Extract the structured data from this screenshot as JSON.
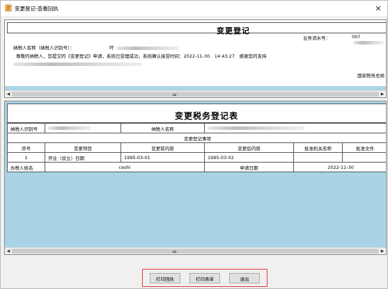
{
  "window": {
    "title": "变更登记-查看回执",
    "close_glyph": "✕"
  },
  "receipt": {
    "title": "变更登记",
    "serial_label": "业务流水号：",
    "serial_value": "007",
    "taxpayer_label": "纳税人名称（纳税人识别号）：",
    "taxpayer_value": "叶",
    "notice": "尊敬的纳税人，您提交的《变更登记》申请，系统已受理成功，系统确认接受时间：2022-11-30　14:43:27　感谢您的支持",
    "bureau": "国家税务总局"
  },
  "form": {
    "title": "变更税务登记表",
    "taxpayer_id_label": "纳税人识别号",
    "taxpayer_id_value": "91...",
    "taxpayer_name_label": "纳税人名称",
    "taxpayer_name_value": "叶...",
    "section_label": "变更登记事项",
    "columns": [
      "序号",
      "变更项目",
      "变更前内容",
      "变更后内容",
      "批准机关名称",
      "批准文件"
    ],
    "rows": [
      {
        "seq": "1",
        "item": "开业（设立）日期",
        "before": "1995-03-01",
        "after": "1995-03-02",
        "authority": "",
        "document": ""
      }
    ],
    "handler_label": "办税人姓名",
    "handler_value": "ceshi",
    "apply_date_label": "申请日期",
    "apply_date_value": "2022-11-30"
  },
  "buttons": {
    "print_receipt": "打印回执",
    "print_form": "打印表单",
    "exit": "退出"
  },
  "colors": {
    "panel_blue": "#a8d4e6",
    "highlight_red": "#e0393e"
  }
}
